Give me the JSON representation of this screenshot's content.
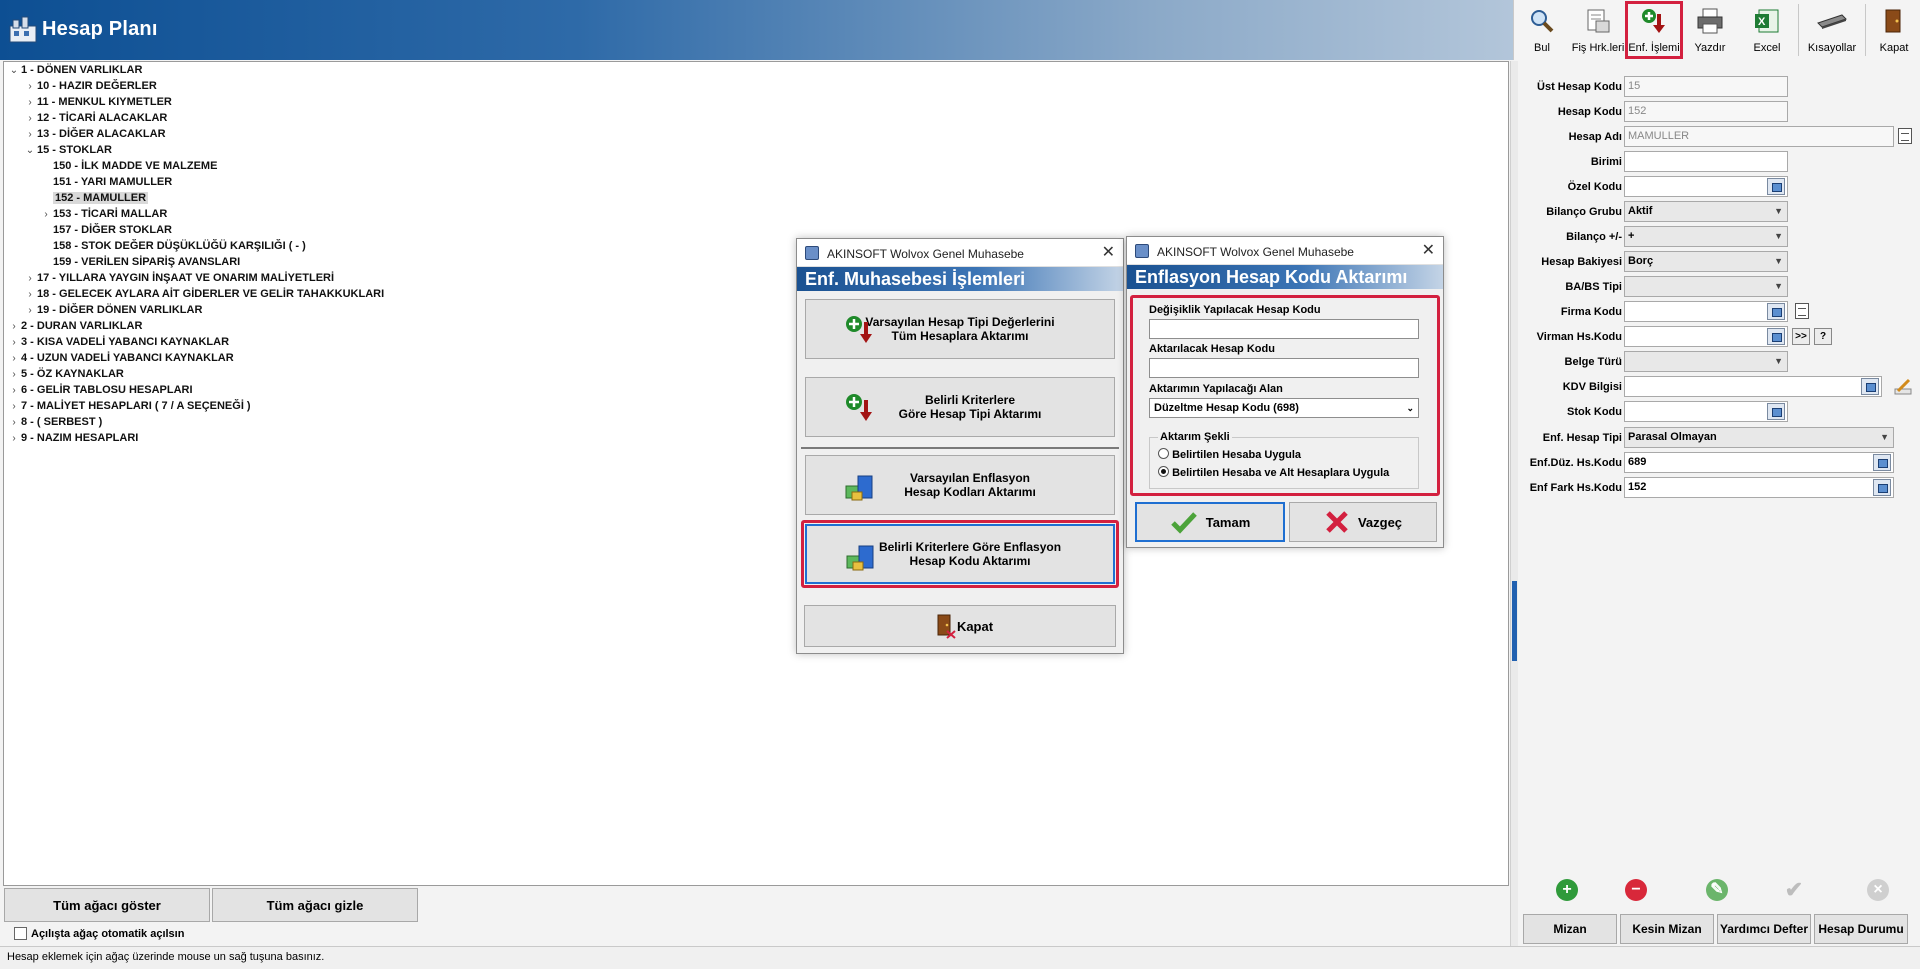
{
  "window": {
    "title": "Hesap Planı"
  },
  "toolbar": {
    "buttons": [
      {
        "label": "Bul",
        "icon": "magnifier-icon"
      },
      {
        "label": "Fiş Hrk.leri",
        "icon": "document-list-icon"
      },
      {
        "label": "Enf. İşlemi",
        "icon": "add-arrow-down-icon",
        "highlighted": true
      },
      {
        "label": "Yazdır",
        "icon": "printer-icon"
      },
      {
        "label": "Excel",
        "icon": "excel-icon"
      },
      {
        "label": "Kısayollar",
        "icon": "keyboard-icon"
      },
      {
        "label": "Kapat",
        "icon": "door-exit-icon"
      }
    ]
  },
  "tree": {
    "items": [
      {
        "label": "1 - DÖNEN VARLIKLAR",
        "level": 0,
        "state": "expanded"
      },
      {
        "label": "10 - HAZIR DEĞERLER",
        "level": 1,
        "state": "collapsed"
      },
      {
        "label": "11 - MENKUL KIYMETLER",
        "level": 1,
        "state": "collapsed"
      },
      {
        "label": "12 - TİCARİ ALACAKLAR",
        "level": 1,
        "state": "collapsed"
      },
      {
        "label": "13 - DİĞER ALACAKLAR",
        "level": 1,
        "state": "collapsed"
      },
      {
        "label": "15 - STOKLAR",
        "level": 1,
        "state": "expanded"
      },
      {
        "label": "150 - İLK MADDE VE MALZEME",
        "level": 2,
        "state": "leaf"
      },
      {
        "label": "151 - YARI MAMULLER",
        "level": 2,
        "state": "leaf"
      },
      {
        "label": "152 - MAMULLER",
        "level": 2,
        "state": "leaf",
        "selected": true
      },
      {
        "label": "153 - TİCARİ MALLAR",
        "level": 2,
        "state": "collapsed"
      },
      {
        "label": "157 - DİĞER STOKLAR",
        "level": 2,
        "state": "leaf"
      },
      {
        "label": "158 - STOK DEĞER DÜŞÜKLÜĞÜ KARŞILIĞI ( - )",
        "level": 2,
        "state": "leaf"
      },
      {
        "label": "159 - VERİLEN SİPARİŞ AVANSLARI",
        "level": 2,
        "state": "leaf"
      },
      {
        "label": "17 - YILLARA YAYGIN İNŞAAT VE ONARIM MALİYETLERİ",
        "level": 1,
        "state": "collapsed"
      },
      {
        "label": "18 - GELECEK AYLARA AİT GİDERLER VE GELİR TAHAKKUKLARI",
        "level": 1,
        "state": "collapsed"
      },
      {
        "label": "19 - DİĞER DÖNEN VARLIKLAR",
        "level": 1,
        "state": "collapsed"
      },
      {
        "label": "2 - DURAN VARLIKLAR",
        "level": 0,
        "state": "collapsed"
      },
      {
        "label": "3 - KISA VADELİ YABANCI KAYNAKLAR",
        "level": 0,
        "state": "collapsed"
      },
      {
        "label": "4 - UZUN VADELİ YABANCI KAYNAKLAR",
        "level": 0,
        "state": "collapsed"
      },
      {
        "label": "5 - ÖZ KAYNAKLAR",
        "level": 0,
        "state": "collapsed"
      },
      {
        "label": "6 - GELİR TABLOSU HESAPLARI",
        "level": 0,
        "state": "collapsed"
      },
      {
        "label": "7 - MALİYET HESAPLARI ( 7 / A  SEÇENEĞİ )",
        "level": 0,
        "state": "collapsed"
      },
      {
        "label": "8 - ( SERBEST )",
        "level": 0,
        "state": "collapsed"
      },
      {
        "label": "9 - NAZIM HESAPLARI",
        "level": 0,
        "state": "collapsed"
      }
    ],
    "show_all_label": "Tüm ağacı göster",
    "hide_all_label": "Tüm ağacı gizle",
    "auto_open_label": "Açılışta ağaç otomatik açılsın"
  },
  "status": {
    "text": "Hesap eklemek için ağaç üzerinde mouse un sağ tuşuna basınız."
  },
  "form": {
    "ust_hesap_kodu": {
      "label": "Üst Hesap Kodu",
      "value": "15"
    },
    "hesap_kodu": {
      "label": "Hesap Kodu",
      "value": "152"
    },
    "hesap_adi": {
      "label": "Hesap Adı",
      "value": "MAMULLER"
    },
    "birimi": {
      "label": "Birimi",
      "value": ""
    },
    "ozel_kodu": {
      "label": "Özel Kodu",
      "value": ""
    },
    "bilanco_grubu": {
      "label": "Bilanço Grubu",
      "value": "Aktif"
    },
    "bilanco_pm": {
      "label": "Bilanço +/-",
      "value": "+"
    },
    "hesap_bakiyesi": {
      "label": "Hesap Bakiyesi",
      "value": "Borç"
    },
    "ba_bs_tipi": {
      "label": "BA/BS Tipi",
      "value": ""
    },
    "firma_kodu": {
      "label": "Firma Kodu",
      "value": ""
    },
    "virman": {
      "label": "Virman Hs.Kodu",
      "value": "",
      "btn_next": ">>",
      "btn_help": "?"
    },
    "belge_turu": {
      "label": "Belge Türü",
      "value": ""
    },
    "kdv_bilgisi": {
      "label": "KDV Bilgisi",
      "value": ""
    },
    "stok_kodu": {
      "label": "Stok Kodu",
      "value": ""
    },
    "enf_hesap_tipi": {
      "label": "Enf. Hesap Tipi",
      "value": "Parasal Olmayan"
    },
    "enf_duz": {
      "label": "Enf.Düz. Hs.Kodu",
      "value": "689"
    },
    "enf_fark": {
      "label": "Enf Fark Hs.Kodu",
      "value": "152"
    }
  },
  "form_actions": {
    "icons": [
      "add-icon",
      "delete-icon",
      "edit-icon",
      "confirm-icon",
      "cancel-icon"
    ],
    "buttons": [
      "Mizan",
      "Kesin Mizan",
      "Yardımcı Defter",
      "Hesap Durumu"
    ]
  },
  "dialog1": {
    "window_title": "AKINSOFT Wolvox Genel Muhasebe",
    "header": "Enf. Muhasebesi İşlemleri",
    "btn1": {
      "line1": "Varsayılan Hesap Tipi Değerlerini",
      "line2": "Tüm Hesaplara Aktarımı"
    },
    "btn2": {
      "line1": "Belirli Kriterlere",
      "line2": "Göre Hesap Tipi Aktarımı"
    },
    "btn3": {
      "line1": "Varsayılan Enflasyon",
      "line2": "Hesap Kodları Aktarımı"
    },
    "btn4": {
      "line1": "Belirli Kriterlere Göre Enflasyon",
      "line2": "Hesap Kodu Aktarımı"
    },
    "close_label": "Kapat"
  },
  "dialog2": {
    "window_title": "AKINSOFT Wolvox Genel Muhasebe",
    "header": "Enflasyon Hesap Kodu Aktarımı",
    "source_label": "Değişiklik Yapılacak Hesap Kodu",
    "source_value": "",
    "target_label": "Aktarılacak Hesap Kodu",
    "target_value": "",
    "field_label": "Aktarımın Yapılacağı Alan",
    "field_value": "Düzeltme Hesap Kodu (698)",
    "group_label": "Aktarım Şekli",
    "radio1": "Belirtilen Hesaba Uygula",
    "radio2": "Belirtilen Hesaba ve Alt Hesaplara Uygula",
    "ok_label": "Tamam",
    "cancel_label": "Vazgeç"
  },
  "colors": {
    "title_blue": "#0d4f93",
    "highlight_red": "#d3203f",
    "band_blue": "#1a5191"
  }
}
